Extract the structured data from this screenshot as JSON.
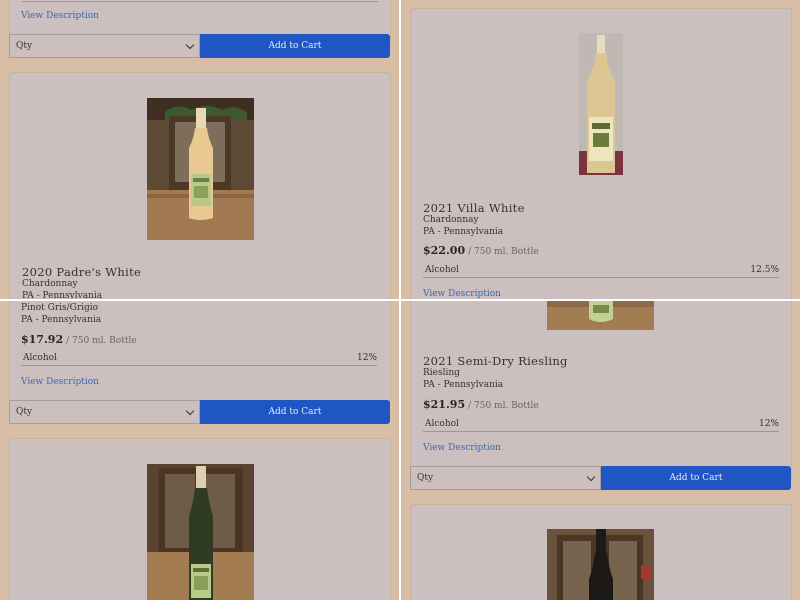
{
  "common": {
    "view_description": "View Description",
    "qty_label": "Qty",
    "add_to_cart": "Add to Cart",
    "alcohol_label": "Alcohol",
    "unit": "/ 750 ml. Bottle"
  },
  "products": {
    "padres_white": {
      "title": "2020 Padre's White",
      "varietal": "Chardonnay",
      "region": "PA - Pennsylvania",
      "varietal2": "Pinot Gris/Grigio",
      "region2": "PA - Pennsylvania",
      "price": "$17.92",
      "alcohol": "12%"
    },
    "villa_white": {
      "title": "2021 Villa White",
      "varietal": "Chardonnay",
      "region": "PA - Pennsylvania",
      "price": "$22.00",
      "alcohol": "12.5%"
    },
    "semi_dry_riesling": {
      "title": "2021 Semi-Dry Riesling",
      "varietal": "Riesling",
      "region": "PA - Pennsylvania",
      "price": "$21.95",
      "alcohol": "12%"
    }
  },
  "colors": {
    "background": "#d8bea4",
    "card": "#cbbfbf",
    "accent_button": "#1f56c3",
    "link": "#3f68ad"
  }
}
